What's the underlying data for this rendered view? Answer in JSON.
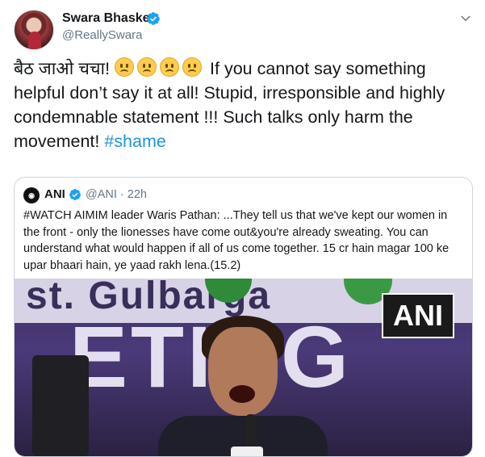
{
  "tweet": {
    "author_name": "Swara Bhasker",
    "author_handle": "@ReallySwara",
    "text_prefix": "बैठ जाओ चचा!",
    "emoji_name": "worried-face-emoji",
    "emoji_count": 4,
    "text_main": " If you cannot say something helpful don’t say it at all! Stupid, irresponsible and highly condemnable statement !!! Such talks only harm the movement! ",
    "hashtag": "#shame",
    "colors": {
      "link": "#1b95e0",
      "verified": "#1da1f2",
      "muted": "#657786"
    }
  },
  "quoted_tweet": {
    "author_name": "ANI",
    "meta": "@ANI · 22h",
    "text": "#WATCH AIMIM leader Waris Pathan: ...They tell us that we've kept our women in the front - only the lionesses have come out&you're already sweating. You can understand what would happen if all of us come together. 15 cr hain magar 100 ke upar bhaari hain, ye yaad rakh lena.(15.2)",
    "media": {
      "banner_text": "st. Gulbarga",
      "background_letters": "ETING",
      "watermark": "ANI"
    }
  }
}
